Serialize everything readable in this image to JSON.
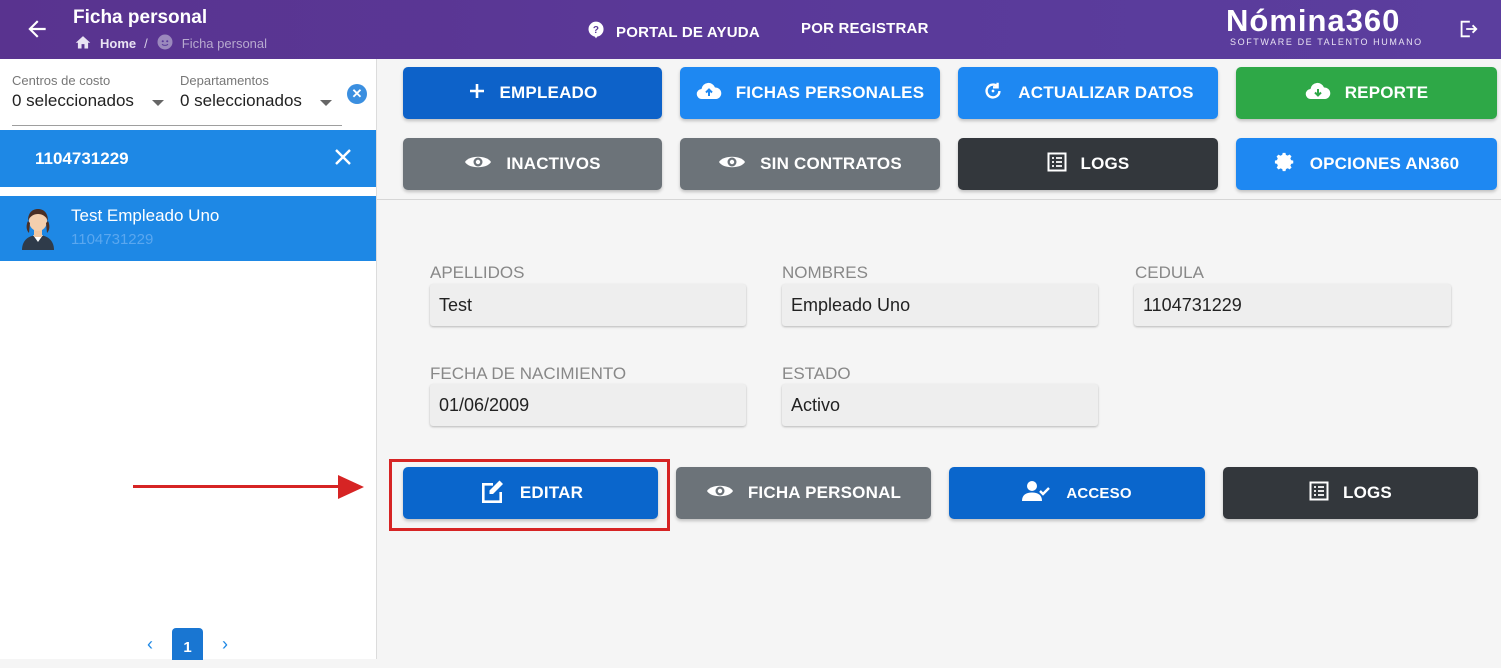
{
  "header": {
    "title": "Ficha personal",
    "breadcrumb_home": "Home",
    "breadcrumb_separator": "/",
    "breadcrumb_current": "Ficha personal",
    "help_link": "PORTAL DE AYUDA",
    "register_link": "POR REGISTRAR",
    "brand_name": "Nómina360",
    "brand_tagline": "SOFTWARE DE TALENTO HUMANO"
  },
  "sidebar": {
    "filter_cost_centers_label": "Centros de costo",
    "filter_cost_centers_value": "0 seleccionados",
    "filter_departments_label": "Departamentos",
    "filter_departments_value": "0 seleccionados",
    "search_value": "1104731229",
    "employee": {
      "name": "Test Empleado Uno",
      "id": "1104731229"
    },
    "pagination": {
      "current_page": "1"
    }
  },
  "toolbar": {
    "employee": "EMPLEADO",
    "personal_records": "FICHAS PERSONALES",
    "update_data": "ACTUALIZAR DATOS",
    "report": "REPORTE",
    "inactive": "INACTIVOS",
    "no_contracts": "SIN CONTRATOS",
    "logs": "LOGS",
    "options": "OPCIONES AN360"
  },
  "details": {
    "surname_label": "APELLIDOS",
    "surname_value": "Test",
    "names_label": "NOMBRES",
    "names_value": "Empleado Uno",
    "id_label": "CEDULA",
    "id_value": "1104731229",
    "birth_label": "FECHA DE NACIMIENTO",
    "birth_value": "01/06/2009",
    "status_label": "ESTADO",
    "status_value": "Activo"
  },
  "actions": {
    "edit": "EDITAR",
    "personal_record": "FICHA PERSONAL",
    "access": "ACCESO",
    "logs": "LOGS"
  },
  "colors": {
    "header": "#59338f",
    "primary": "#1e88e5",
    "annotation": "#d62424"
  }
}
